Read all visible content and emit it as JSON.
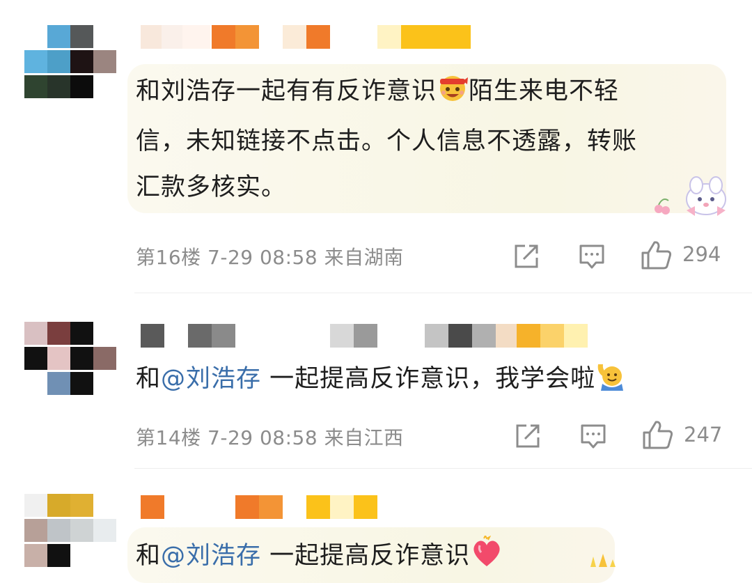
{
  "comments": [
    {
      "text_lines": [
        "和刘浩存一起有有反诈意识",
        "陌生来电不轻",
        "信，未知链接不点击。个人信息不透露，转账",
        "汇款多核实。"
      ],
      "emoji": "grinning-headband-emoji",
      "floor": "第16楼",
      "datetime": "7-29 08:58",
      "location": "来自湖南",
      "likes": "294"
    },
    {
      "prefix": "和",
      "mention": "@刘浩存",
      "suffix": " 一起提高反诈意识，我学会啦",
      "emoji": "raising-hand-emoji",
      "floor": "第14楼",
      "datetime": "7-29 08:58",
      "location": "来自江西",
      "likes": "247"
    },
    {
      "prefix": "和",
      "mention": "@刘浩存",
      "suffix": " 一起提高反诈意识",
      "emoji": "heart-emoji"
    }
  ],
  "colors": {
    "mention": "#3a6eaa",
    "meta_text": "#8c8c8c",
    "bubble": "#f8f6e4"
  },
  "icons": [
    "share-icon",
    "reply-icon",
    "like-icon"
  ]
}
